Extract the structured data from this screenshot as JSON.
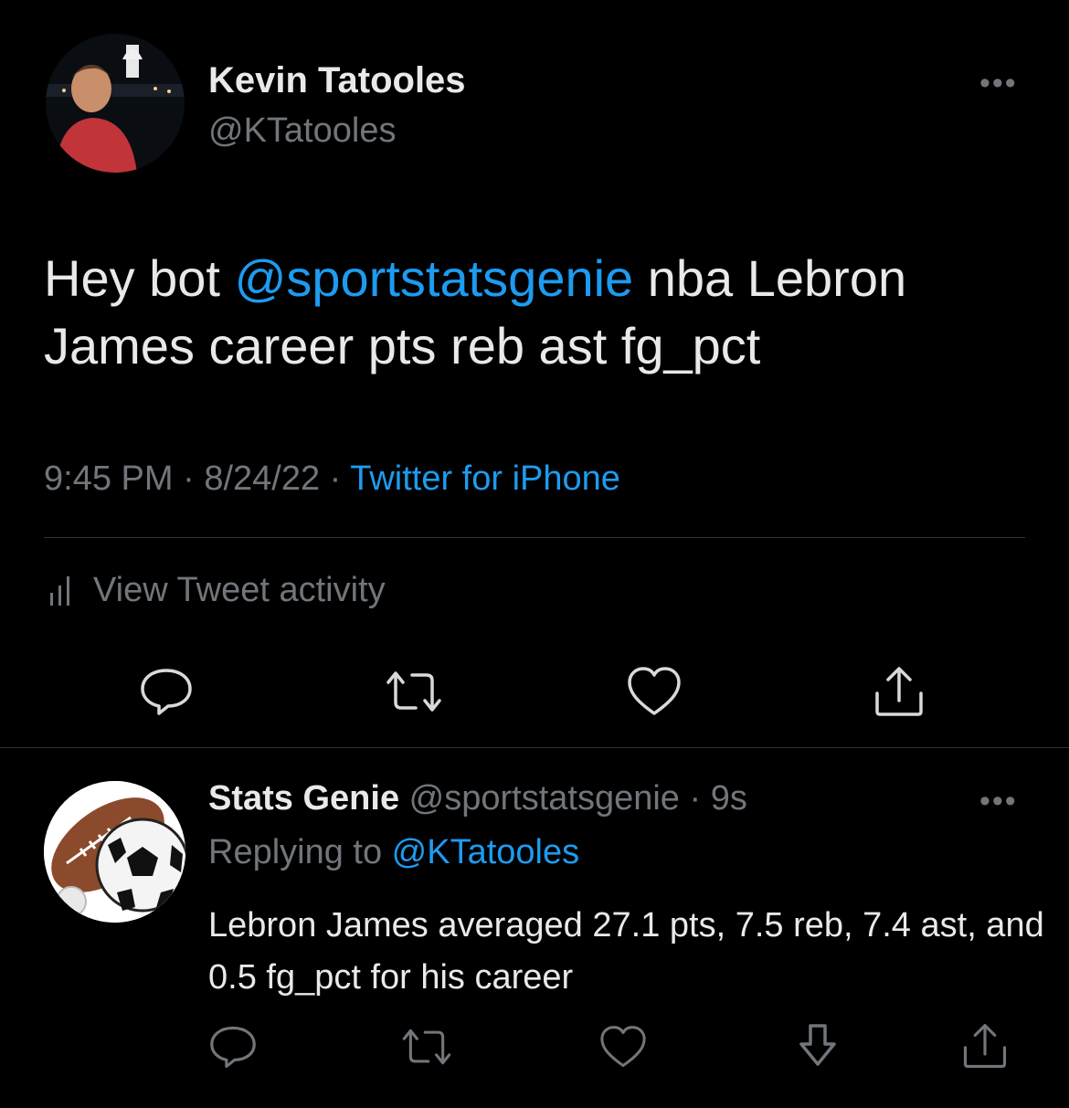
{
  "tweet": {
    "author_name": "Kevin Tatooles",
    "author_handle": "@KTatooles",
    "text_prefix": "Hey bot ",
    "text_mention": "@sportstatsgenie",
    "text_suffix": " nba Lebron James career pts reb ast fg_pct",
    "time": "9:45 PM",
    "separator": " · ",
    "date": "8/24/22",
    "source": "Twitter for iPhone",
    "activity_label": "View Tweet activity",
    "more_label": "•••"
  },
  "reply": {
    "author_name": "Stats Genie",
    "author_handle": "@sportstatsgenie",
    "separator": " · ",
    "time_ago": "9s",
    "replying_prefix": "Replying to ",
    "replying_mention": "@KTatooles",
    "text": "Lebron James averaged 27.1 pts, 7.5 reb, 7.4 ast, and 0.5 fg_pct for his career",
    "more_label": "•••"
  },
  "icons": {
    "reply": "reply-icon",
    "retweet": "retweet-icon",
    "like": "heart-icon",
    "bookmark": "bookmark-icon",
    "share": "share-icon",
    "activity": "bar-chart-icon"
  },
  "colors": {
    "background": "#000000",
    "text": "#e7e9ea",
    "secondary": "#71767b",
    "accent": "#1d9bf0",
    "divider": "#2f3336"
  }
}
